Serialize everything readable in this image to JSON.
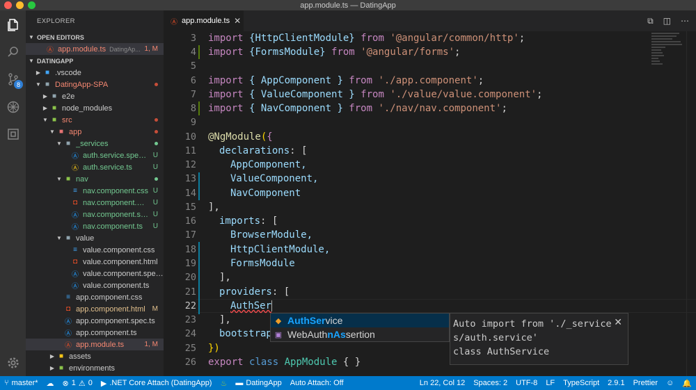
{
  "window": {
    "title": "app.module.ts — DatingApp"
  },
  "activity": {
    "scm_badge": "8"
  },
  "sidebar": {
    "header": "EXPLORER",
    "open_editors_label": "OPEN EDITORS",
    "open_editor": {
      "name": "app.module.ts",
      "path": "DatingAp...",
      "status": "1, M"
    },
    "project_label": "DATINGAPP",
    "tree": [
      {
        "name": ".vscode",
        "status": ""
      },
      {
        "name": "DatingApp-SPA",
        "status": ""
      },
      {
        "name": "e2e",
        "status": ""
      },
      {
        "name": "node_modules",
        "status": ""
      },
      {
        "name": "src",
        "status": ""
      },
      {
        "name": "app",
        "status": ""
      },
      {
        "name": "_services",
        "status": ""
      },
      {
        "name": "auth.service.spec....",
        "status": "U"
      },
      {
        "name": "auth.service.ts",
        "status": "U"
      },
      {
        "name": "nav",
        "status": ""
      },
      {
        "name": "nav.component.css",
        "status": "U"
      },
      {
        "name": "nav.component.ht...",
        "status": "U"
      },
      {
        "name": "nav.component.sp...",
        "status": "U"
      },
      {
        "name": "nav.component.ts",
        "status": "U"
      },
      {
        "name": "value",
        "status": ""
      },
      {
        "name": "value.component.css",
        "status": ""
      },
      {
        "name": "value.component.html",
        "status": ""
      },
      {
        "name": "value.component.spec...",
        "status": ""
      },
      {
        "name": "value.component.ts",
        "status": ""
      },
      {
        "name": "app.component.css",
        "status": ""
      },
      {
        "name": "app.component.html",
        "status": "M"
      },
      {
        "name": "app.component.spec.ts",
        "status": ""
      },
      {
        "name": "app.component.ts",
        "status": ""
      },
      {
        "name": "app.module.ts",
        "status": "1, M"
      },
      {
        "name": "assets",
        "status": ""
      },
      {
        "name": "environments",
        "status": ""
      }
    ]
  },
  "editor": {
    "tab_label": "app.module.ts",
    "line_numbers": [
      "3",
      "4",
      "5",
      "6",
      "7",
      "8",
      "9",
      "10",
      "11",
      "12",
      "13",
      "14",
      "15",
      "16",
      "17",
      "18",
      "19",
      "20",
      "21",
      "22",
      "23",
      "24",
      "25",
      "26"
    ],
    "code": {
      "l3": [
        "import ",
        "{HttpClientModule}",
        " from ",
        "'@angular/common/http'",
        ";"
      ],
      "l4": [
        "import ",
        "{FormsModule}",
        " from ",
        "'@angular/forms'",
        ";"
      ],
      "l6": [
        "import ",
        "{ AppComponent }",
        " from ",
        "'./app.component'",
        ";"
      ],
      "l7": [
        "import ",
        "{ ValueComponent }",
        " from ",
        "'./value/value.component'",
        ";"
      ],
      "l8": [
        "import ",
        "{ NavComponent }",
        " from ",
        "'./nav/nav.component'",
        ";"
      ],
      "l10": [
        "@NgModule",
        "(",
        "{"
      ],
      "l11": [
        "declarations",
        ": ["
      ],
      "l12": "AppComponent,",
      "l13": "ValueComponent,",
      "l14": "NavComponent",
      "l15": "],",
      "l16": [
        "imports",
        ": ["
      ],
      "l17": "BrowserModule,",
      "l18": "HttpClientModule,",
      "l19": "FormsModule",
      "l20": "],",
      "l21": [
        "providers",
        ": ["
      ],
      "l22": "AuthSer",
      "l23": "],",
      "l24": "bootstrap",
      "l25": "})",
      "l26": [
        "export ",
        "class ",
        "AppModule",
        " { }"
      ]
    }
  },
  "suggest": {
    "items": [
      {
        "hl": "AuthSer",
        "rest": "vice"
      },
      {
        "pre1": "WebAuth",
        "hl1": "nAs",
        "mid": "ser",
        "rest": "tion"
      }
    ],
    "item2_full": "WebAuthnAssertion",
    "details": [
      "Auto import from './_service",
      "s/auth.service'",
      "class AuthService"
    ]
  },
  "statusbar": {
    "branch": "master*",
    "errors": "1",
    "warnings": "0",
    "debug": ".NET Core Attach (DatingApp)",
    "folder": "DatingApp",
    "auto_attach": "Auto Attach: Off",
    "position": "Ln 22, Col 12",
    "spaces": "Spaces: 2",
    "encoding": "UTF-8",
    "eol": "LF",
    "language": "TypeScript",
    "ts_version": "2.9.1",
    "formatter": "Prettier"
  }
}
